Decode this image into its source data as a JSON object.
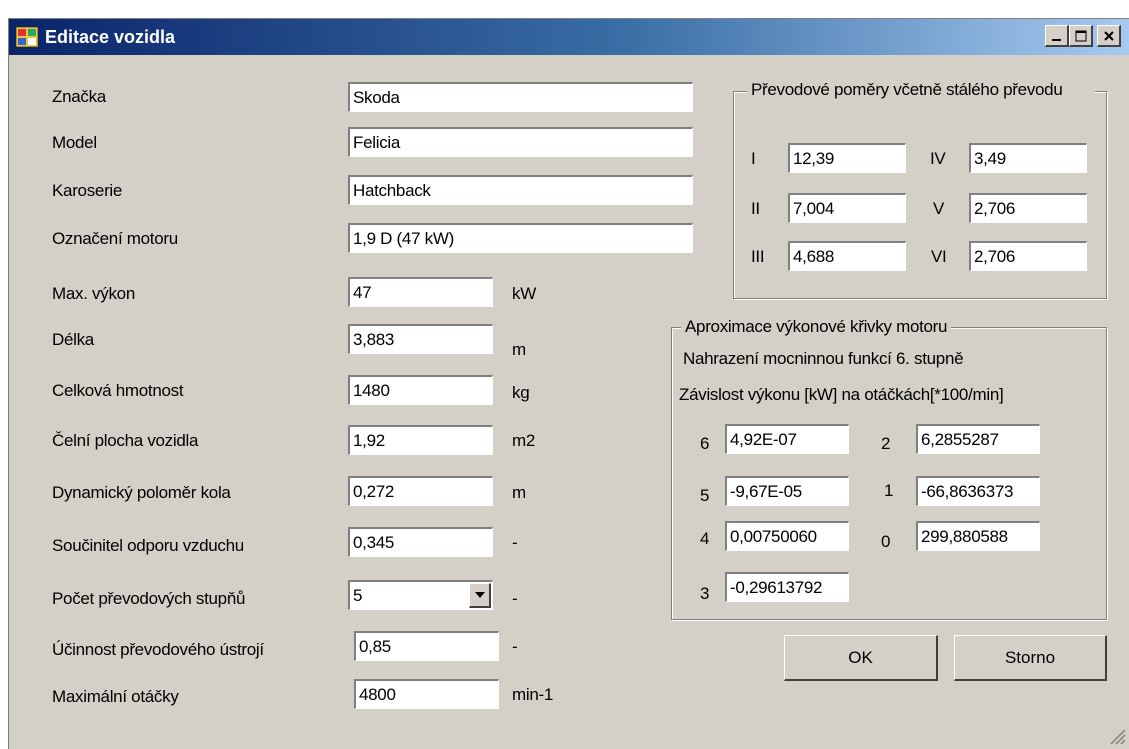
{
  "window": {
    "title": "Editace vozidla"
  },
  "vehicle": {
    "fields": [
      {
        "label": "Značka",
        "value": "Skoda"
      },
      {
        "label": "Model",
        "value": "Felicia"
      },
      {
        "label": "Karoserie",
        "value": "Hatchback"
      },
      {
        "label": "Označení motoru",
        "value": "1,9 D (47 kW)"
      }
    ],
    "params": [
      {
        "label": "Max. výkon",
        "value": "47",
        "unit": "kW"
      },
      {
        "label": "Délka",
        "value": "3,883",
        "unit": "m"
      },
      {
        "label": "Celková hmotnost",
        "value": "1480",
        "unit": "kg"
      },
      {
        "label": "Čelní plocha vozidla",
        "value": "1,92",
        "unit": "m2"
      },
      {
        "label": "Dynamický poloměr kola",
        "value": "0,272",
        "unit": "m"
      },
      {
        "label": "Součinitel odporu vzduchu",
        "value": "0,345",
        "unit": "-"
      },
      {
        "label": "Počet převodových stupňů",
        "value": "5",
        "unit": "-"
      },
      {
        "label": "Účinnost převodového ústrojí",
        "value": "0,85",
        "unit": "-"
      },
      {
        "label": "Maximální otáčky",
        "value": "4800",
        "unit": "min-1"
      }
    ]
  },
  "gears": {
    "title": "Převodové poměry včetně stálého převodu",
    "items": [
      {
        "label": "I",
        "value": "12,39"
      },
      {
        "label": "II",
        "value": "7,004"
      },
      {
        "label": "III",
        "value": "4,688"
      },
      {
        "label": "IV",
        "value": "3,49"
      },
      {
        "label": "V",
        "value": "2,706"
      },
      {
        "label": "VI",
        "value": "2,706"
      }
    ]
  },
  "approx": {
    "title": "Aproximace výkonové křivky motoru",
    "line1": "Nahrazení mocninnou funkcí 6. stupně",
    "line2": "Závislost výkonu [kW] na otáčkách[*100/min]",
    "coefs": [
      {
        "label": "6",
        "value": "4,92E-07"
      },
      {
        "label": "5",
        "value": "-9,67E-05"
      },
      {
        "label": "4",
        "value": "0,00750060"
      },
      {
        "label": "3",
        "value": "-0,29613792"
      },
      {
        "label": "2",
        "value": "6,2855287"
      },
      {
        "label": "1",
        "value": "-66,8636373"
      },
      {
        "label": "0",
        "value": "299,880588"
      }
    ]
  },
  "buttons": {
    "ok": "OK",
    "cancel": "Storno"
  }
}
